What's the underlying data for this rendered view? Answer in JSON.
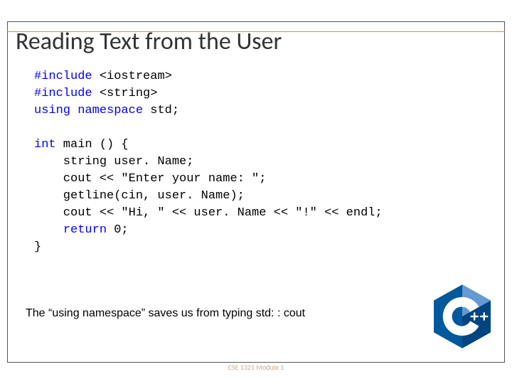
{
  "title": "Reading Text from the User",
  "code": {
    "l1a": "#include",
    "l1b": " <iostream>",
    "l2a": "#include",
    "l2b": " <string>",
    "l3a": "using",
    "l3b": " ",
    "l3c": "namespace",
    "l3d": " std;",
    "l4": "",
    "l5a": "int",
    "l5b": " main () {",
    "l6": "    string user. Name;",
    "l7": "    cout << \"Enter your name: \";",
    "l8": "    getline(cin, user. Name);",
    "l9": "    cout << \"Hi, \" << user. Name << \"!\" << endl;",
    "l10a": "    ",
    "l10b": "return",
    "l10c": " 0;",
    "l11": "}"
  },
  "note": "The “using namespace” saves us from typing std: : cout",
  "footer": {
    "left": "",
    "center": "CSE 1321 Module 1",
    "right": ""
  },
  "logo_label": "C++"
}
